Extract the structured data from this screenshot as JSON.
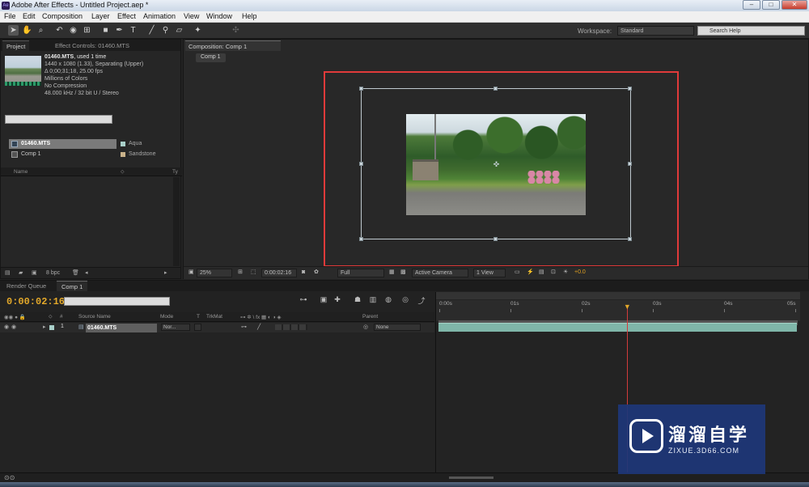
{
  "window": {
    "title": "Adobe After Effects - Untitled Project.aep *",
    "minimize": "–",
    "maximize": "□",
    "close": "✕"
  },
  "menu": [
    "File",
    "Edit",
    "Composition",
    "Layer",
    "Effect",
    "Animation",
    "View",
    "Window",
    "Help"
  ],
  "toolbar": {
    "tools": [
      "selection-tool",
      "hand-tool",
      "zoom-tool",
      "rotation-tool",
      "camera-tool",
      "pan-behind-tool",
      "rectangle-tool",
      "pen-tool",
      "type-tool",
      "brush-tool",
      "clone-stamp-tool",
      "eraser-tool",
      "roto-brush-tool",
      "puppet-tool"
    ],
    "workspace_label": "Workspace:",
    "workspace_value": "Standard",
    "search_help_placeholder": "Search Help"
  },
  "project_panel": {
    "tabs": [
      "Project",
      "Effect Controls: 01460.MTS"
    ],
    "info": {
      "name": "01460.MTS",
      "used": ", used 1 time",
      "line2": "1440 x 1080 (1.33), Separating (Upper)",
      "line3": "Δ 0;00;31;18, 25.00 fps",
      "line4": "Millions of Colors",
      "line5": "No Compression",
      "line6": "48.000 kHz / 32 bit U / Stereo"
    },
    "columns": {
      "name": "Name",
      "type": "Ty"
    },
    "items": [
      {
        "name": "01460.MTS",
        "label": "Aqua",
        "color": "#a9cfc9",
        "selected": true
      },
      {
        "name": "Comp 1",
        "label": "Sandstone",
        "color": "#c9b28a",
        "selected": false
      }
    ],
    "bpc": "8 bpc"
  },
  "comp_panel": {
    "tab": "Composition: Comp 1",
    "breadcrumb": "Comp 1",
    "viewer_bar": {
      "zoom": "25%",
      "timecode": "0:00:02:16",
      "resolution": "Full",
      "camera": "Active Camera",
      "views": "1 View",
      "exposure": "+0.0"
    }
  },
  "timeline": {
    "tabs": [
      "Render Queue",
      "Comp 1"
    ],
    "timecode": "0:00:02:16",
    "columns": {
      "num": "#",
      "source": "Source Name",
      "mode": "Mode",
      "t": "T",
      "trkmat": "TrkMat",
      "parent": "Parent"
    },
    "layers": [
      {
        "index": "1",
        "name": "01460.MTS",
        "mode": "Nor...",
        "parent": "None"
      }
    ],
    "ruler": [
      "0:00s",
      "01s",
      "02s",
      "03s",
      "04s",
      "05s"
    ],
    "playhead_seconds": 2.64,
    "duration_seconds": 5
  },
  "watermark": {
    "brand": "溜溜自学",
    "url": "ZIXUE.3D66.COM"
  }
}
